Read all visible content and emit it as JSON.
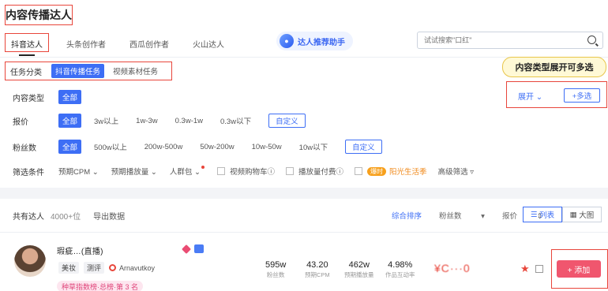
{
  "page_title": "内容传播达人",
  "tabs": [
    "抖音达人",
    "头条创作者",
    "西瓜创作者",
    "火山达人"
  ],
  "assistant_label": "达人推荐助手",
  "search": {
    "placeholder": "试试搜索\"口红\""
  },
  "task": {
    "label": "任务分类",
    "options": [
      "抖音传播任务",
      "视频素材任务"
    ]
  },
  "callout": "内容类型展开可多选",
  "content_type": {
    "label": "内容类型",
    "selected": "全部",
    "expand": "展开",
    "multi": "+多选"
  },
  "price": {
    "label": "报价",
    "options": [
      "全部",
      "3w以上",
      "1w-3w",
      "0.3w-1w",
      "0.3w以下"
    ],
    "custom": "自定义"
  },
  "fans": {
    "label": "粉丝数",
    "options": [
      "全部",
      "500w以上",
      "200w-500w",
      "50w-200w",
      "10w-50w",
      "10w以下"
    ],
    "custom": "自定义"
  },
  "conditions": {
    "label": "筛选条件",
    "dropdowns": [
      "预期CPM",
      "预期播放量",
      "人群包"
    ],
    "checks": [
      "视频购物车",
      "播放量付费"
    ],
    "hot_badge": "爆时",
    "sunshine": "阳光生活季",
    "advanced": "高级筛选"
  },
  "summary": {
    "label": "共有达人",
    "count": "4000+位",
    "export": "导出数据"
  },
  "sorts": [
    "综合排序",
    "粉丝数",
    "报价"
  ],
  "views": [
    "列表",
    "大图"
  ],
  "creator": {
    "name": "瑕疵…(直播)",
    "tags": [
      "美妆",
      "测评"
    ],
    "handle": "Arnavutkoy",
    "rank": "种草指数榜·总榜·第 3 名",
    "metrics": [
      {
        "value": "595w",
        "label": "粉丝数"
      },
      {
        "value": "43.20",
        "label": "预期CPM"
      },
      {
        "value": "462w",
        "label": "预期播放量"
      },
      {
        "value": "4.98%",
        "label": "作品互动率"
      }
    ],
    "price_blur": "¥C···0",
    "add": "+ 添加"
  }
}
